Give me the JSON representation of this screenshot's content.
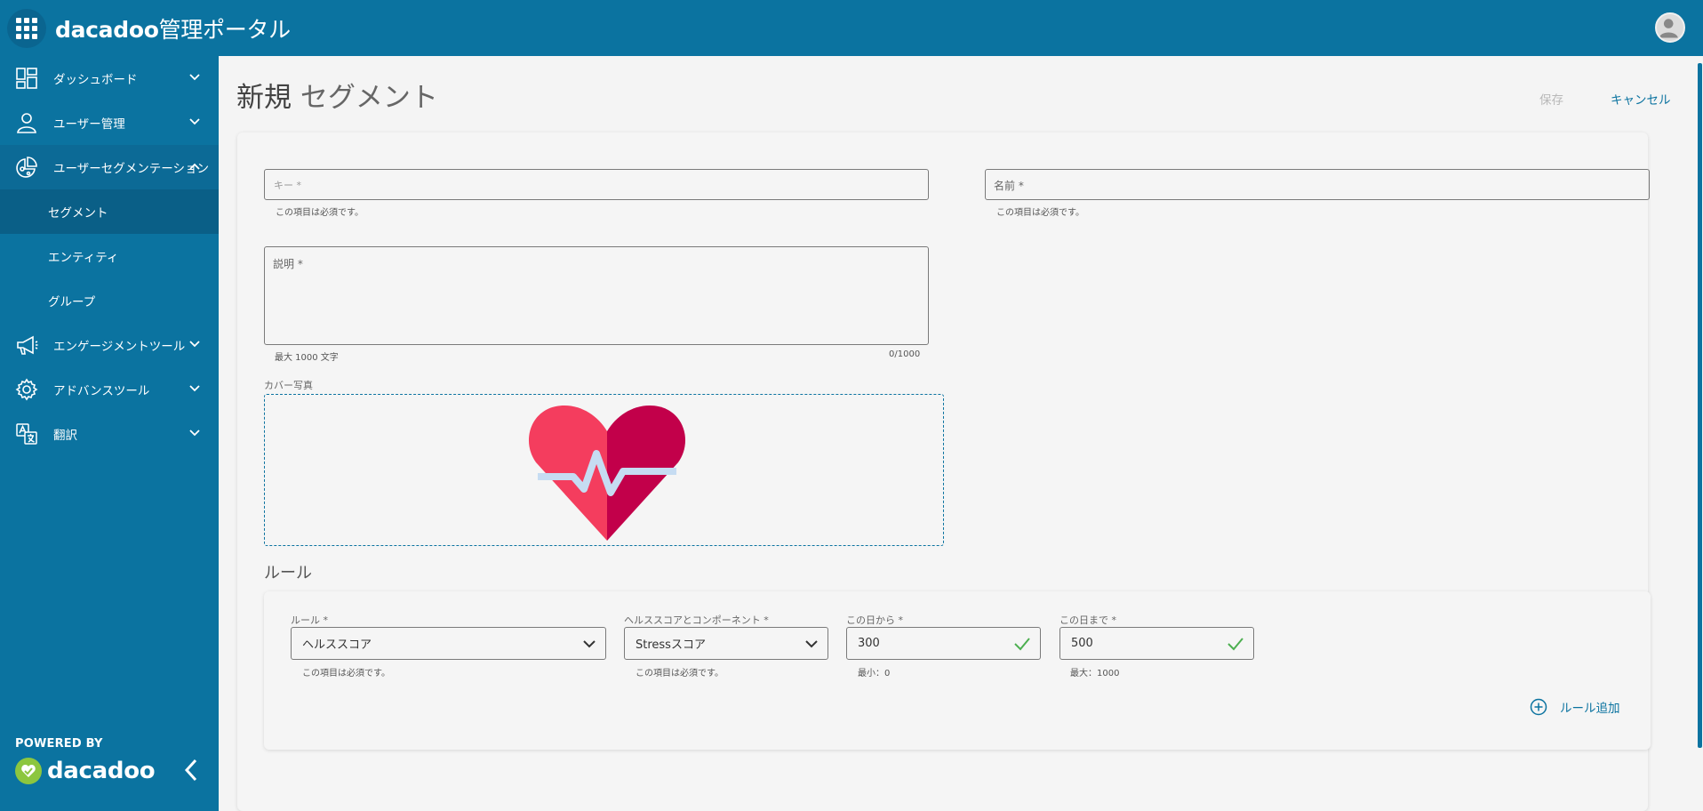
{
  "header": {
    "brand_bold": "dacadoo",
    "brand_light": " 管理ポータル"
  },
  "sidebar": {
    "items": [
      {
        "label": "ダッシュボード",
        "icon": "dashboard-icon"
      },
      {
        "label": "ユーザー管理",
        "icon": "user-icon"
      },
      {
        "label": "ユーザーセグメンテーション",
        "icon": "segmentation-icon"
      },
      {
        "label": "エンゲージメントツール",
        "icon": "megaphone-icon"
      },
      {
        "label": "アドバンスツール",
        "icon": "gear-icon"
      },
      {
        "label": "翻訳",
        "icon": "translate-icon"
      }
    ],
    "sub_items": [
      {
        "label": "セグメント"
      },
      {
        "label": "エンティティ"
      },
      {
        "label": "グループ"
      }
    ],
    "powered_by": "POWERED BY",
    "footer_brand": "dacadoo"
  },
  "page": {
    "title_a": "新規",
    "title_b": " セグメント",
    "save_label": "保存",
    "cancel_label": "キャンセル"
  },
  "form": {
    "key_label": "キー *",
    "key_hint": "この項目は必須です。",
    "name_label": "名前 *",
    "name_hint": "この項目は必須です。",
    "description_label": "説明 *",
    "description_hint": "最大 1000 文字",
    "description_counter": "0/1000",
    "cover_label": "カバー写真"
  },
  "rules": {
    "title": "ルール",
    "rule_label": "ルール *",
    "rule_value": "ヘルススコア",
    "rule_hint": "この項目は必須です。",
    "component_label": "ヘルススコアとコンポーネント *",
    "component_value": "Stressスコア",
    "component_hint": "この項目は必須です。",
    "from_label": "この日から *",
    "from_value": "300",
    "from_hint": "最小：0",
    "to_label": "この日まで *",
    "to_value": "500",
    "to_hint": "最大：1000",
    "add_rule_a": "ルール",
    "add_rule_b": " 追加"
  },
  "colors": {
    "brand_blue": "#0b73a0",
    "valid_green": "#4caf50",
    "heart_left": "#f43d5e",
    "heart_right": "#c2004a"
  }
}
